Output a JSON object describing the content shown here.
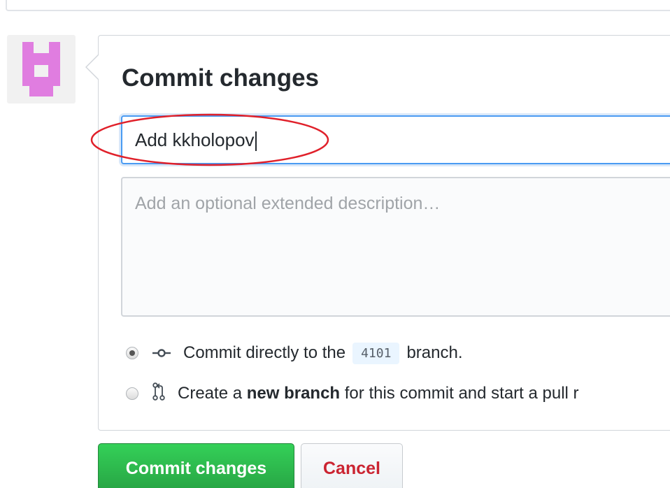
{
  "commit_form": {
    "heading": "Commit changes",
    "summary_value": "Add kkholopov",
    "description_placeholder": "Add an optional extended description…",
    "options": {
      "direct": {
        "prefix": "Commit directly to the",
        "branch": "4101",
        "suffix": "branch."
      },
      "new_branch": {
        "prefix": "Create a",
        "bold": "new branch",
        "suffix": "for this commit and start a pull r"
      }
    },
    "buttons": {
      "commit_label": "Commit changes",
      "cancel_label": "Cancel"
    }
  },
  "icons": {
    "avatar": "identicon-avatar",
    "commit": "git-commit-icon",
    "pull_request": "git-pull-request-icon"
  },
  "colors": {
    "accent_blue": "#4a9bf2",
    "annotation_red": "#e0202a",
    "avatar_pink": "#e07de0",
    "commit_green": "#28a745",
    "cancel_red": "#cb2431"
  }
}
